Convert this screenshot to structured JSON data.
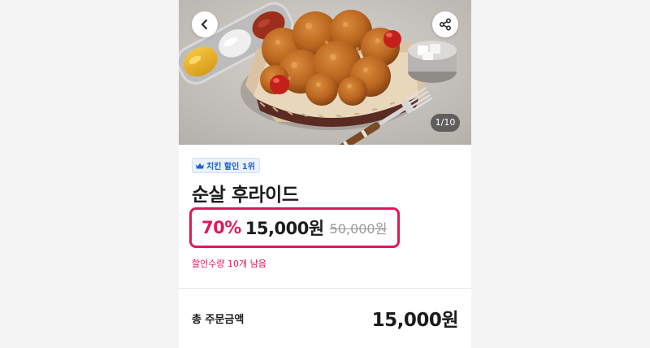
{
  "hero": {
    "image_counter": "1/10",
    "back_icon": "chevron-left-icon",
    "share_icon": "share-icon"
  },
  "product": {
    "badge_icon": "crown-icon",
    "badge_label": "치킨 할인 1위",
    "title": "순살 후라이드",
    "discount_rate": "70%",
    "sale_price": "15,000원",
    "original_price": "50,000원",
    "remaining_notice": "할인수량 10개 남음"
  },
  "order": {
    "total_label": "총 주문금액",
    "total_amount": "15,000원"
  },
  "colors": {
    "accent": "#e0185a",
    "badge_text": "#1e5fd6",
    "badge_bg": "#eaf2fe",
    "text": "#1c1c1c",
    "strike": "#9a9a9a"
  }
}
